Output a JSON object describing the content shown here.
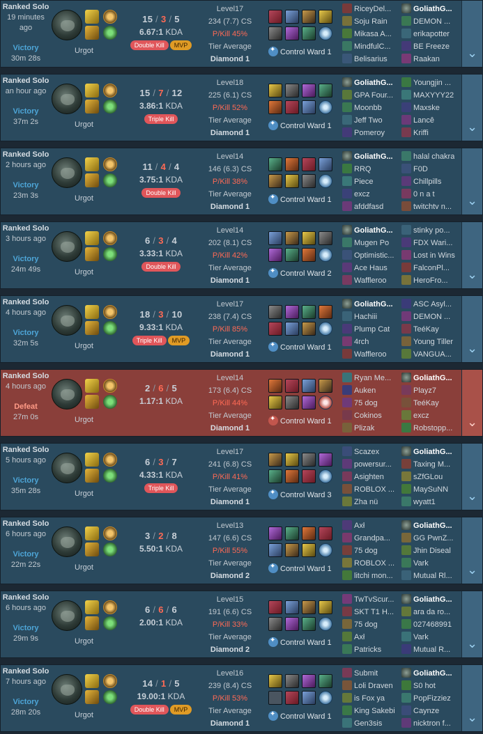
{
  "champion": "Urgot",
  "ward_prefix": "Control Ward",
  "tier_label": "Tier Average",
  "colors": {
    "win_bg": "#2a4a5e",
    "loss_bg": "#8a3f3a",
    "deaths": "#ff6a55",
    "pkill": "#ff6a55",
    "multi_kill": "#e0565a",
    "mvp": "#e09b25"
  },
  "icons": {
    "expand": "chevron-down-icon",
    "ward": "control-ward-icon"
  },
  "matches": [
    {
      "queue": "Ranked Solo",
      "ago": "19 minutes ago",
      "result": "Victory",
      "length": "30m 28s",
      "k": "15",
      "d": "3",
      "a": "5",
      "ratio": "6.67:1",
      "kda_suffix": "KDA",
      "badges": [
        "Double Kill",
        "MVP"
      ],
      "level": "Level17",
      "cs": "234 (7.7) CS",
      "pkill": "P/Kill 45%",
      "tier": "Tier Average",
      "rank": "Diamond 1",
      "wards": "1",
      "team1": [
        "RiceyDel...",
        "Soju Rain",
        "Mikasa A...",
        "MindfulC...",
        "Belisarius"
      ],
      "team2": [
        "GoliathG...",
        "DEMON ...",
        "erikapotter",
        "BE Freeze",
        "Raakan"
      ],
      "me": "2-0"
    },
    {
      "queue": "Ranked Solo",
      "ago": "an hour ago",
      "result": "Victory",
      "length": "37m 2s",
      "k": "15",
      "d": "7",
      "a": "12",
      "ratio": "3.86:1",
      "kda_suffix": "KDA",
      "badges": [
        "Triple Kill"
      ],
      "level": "Level18",
      "cs": "225 (6.1) CS",
      "pkill": "P/Kill 52%",
      "tier": "Tier Average",
      "rank": "Diamond 1",
      "wards": "1",
      "team1": [
        "GoliathG...",
        "GPA Four...",
        "Moonbb",
        "Jeff Two",
        "Pomeroy"
      ],
      "team2": [
        "Youngjin ...",
        "MAXYYY22",
        "Maxske",
        "Lancê",
        "Kriffi"
      ],
      "me": "1-0"
    },
    {
      "queue": "Ranked Solo",
      "ago": "2 hours ago",
      "result": "Victory",
      "length": "23m 3s",
      "k": "11",
      "d": "4",
      "a": "4",
      "ratio": "3.75:1",
      "kda_suffix": "KDA",
      "badges": [
        "Double Kill"
      ],
      "level": "Level14",
      "cs": "146 (6.3) CS",
      "pkill": "P/Kill 38%",
      "tier": "Tier Average",
      "rank": "Diamond 1",
      "wards": "1",
      "team1": [
        "GoliathG...",
        "RRQ",
        "Piece",
        "excz",
        "afddfasd"
      ],
      "team2": [
        "halal chakra",
        "F0D",
        "Chillpills",
        "0 n a t",
        "twitchtv n..."
      ],
      "me": "1-0"
    },
    {
      "queue": "Ranked Solo",
      "ago": "3 hours ago",
      "result": "Victory",
      "length": "24m 49s",
      "k": "6",
      "d": "3",
      "a": "4",
      "ratio": "3.33:1",
      "kda_suffix": "KDA",
      "badges": [
        "Double Kill"
      ],
      "level": "Level14",
      "cs": "202 (8.1) CS",
      "pkill": "P/Kill 42%",
      "tier": "Tier Average",
      "rank": "Diamond 1",
      "wards": "2",
      "team1": [
        "GoliathG...",
        "Mugen Po",
        "Optimistic...",
        "Ace Haus",
        "Waffleroo"
      ],
      "team2": [
        "stinky po...",
        "FDX Wari...",
        "Lost in Wins",
        "FalconPl...",
        "HeroFro..."
      ],
      "me": "1-0"
    },
    {
      "queue": "Ranked Solo",
      "ago": "4 hours ago",
      "result": "Victory",
      "length": "32m 5s",
      "k": "18",
      "d": "3",
      "a": "10",
      "ratio": "9.33:1",
      "kda_suffix": "KDA",
      "badges": [
        "Triple Kill",
        "MVP"
      ],
      "level": "Level17",
      "cs": "238 (7.4) CS",
      "pkill": "P/Kill 85%",
      "tier": "Tier Average",
      "rank": "Diamond 1",
      "wards": "1",
      "team1": [
        "GoliathG...",
        "Hachiii",
        "Plump Cat",
        "4rch",
        "Waffleroo"
      ],
      "team2": [
        "ASC Asyl...",
        "DEMON ...",
        "TeéKay",
        "Young Tiller",
        "VANGUA..."
      ],
      "me": "1-0"
    },
    {
      "queue": "Ranked Solo",
      "ago": "4 hours ago",
      "result": "Defeat",
      "length": "27m 0s",
      "k": "2",
      "d": "6",
      "a": "5",
      "ratio": "1.17:1",
      "kda_suffix": "KDA",
      "badges": [],
      "level": "Level14",
      "cs": "173 (6.4) CS",
      "pkill": "P/Kill 44%",
      "tier": "Tier Average",
      "rank": "Diamond 1",
      "wards": "1",
      "team1": [
        "Ryan Me...",
        "Auken",
        "75 dog",
        "Cokinos",
        "Plizak"
      ],
      "team2": [
        "GoliathG...",
        "Playz7",
        "TeéKay",
        "excz",
        "Robstopp..."
      ],
      "me": "2-0"
    },
    {
      "queue": "Ranked Solo",
      "ago": "5 hours ago",
      "result": "Victory",
      "length": "35m 28s",
      "k": "6",
      "d": "3",
      "a": "7",
      "ratio": "4.33:1",
      "kda_suffix": "KDA",
      "badges": [
        "Triple Kill"
      ],
      "level": "Level17",
      "cs": "241 (6.8) CS",
      "pkill": "P/Kill 41%",
      "tier": "Tier Average",
      "rank": "Diamond 1",
      "wards": "3",
      "team1": [
        "Scazex",
        "powersur...",
        "Asighten",
        "ROBLOX ...",
        "Zha nü"
      ],
      "team2": [
        "GoliathG...",
        "Taxing M...",
        "sZfGLou",
        "MaySuNN",
        "wyatt1"
      ],
      "me": "2-0"
    },
    {
      "queue": "Ranked Solo",
      "ago": "6 hours ago",
      "result": "Victory",
      "length": "22m 22s",
      "k": "3",
      "d": "2",
      "a": "8",
      "ratio": "5.50:1",
      "kda_suffix": "KDA",
      "badges": [],
      "level": "Level13",
      "cs": "147 (6.6) CS",
      "pkill": "P/Kill 55%",
      "tier": "Tier Average",
      "rank": "Diamond 2",
      "wards": "1",
      "team1": [
        "Axł",
        "Grandpa...",
        "75 dog",
        "ROBLOX ...",
        "litchi mon..."
      ],
      "team2": [
        "GoliathG...",
        "GG PwnZ...",
        "Jhin Diseal",
        "Vark",
        "Mutual Rl..."
      ],
      "me": "2-0"
    },
    {
      "queue": "Ranked Solo",
      "ago": "6 hours ago",
      "result": "Victory",
      "length": "29m 9s",
      "k": "6",
      "d": "6",
      "a": "6",
      "ratio": "2.00:1",
      "kda_suffix": "KDA",
      "badges": [],
      "level": "Level15",
      "cs": "191 (6.6) CS",
      "pkill": "P/Kill 33%",
      "tier": "Tier Average",
      "rank": "Diamond 2",
      "wards": "1",
      "team1": [
        "TwTvScur...",
        "SKT T1 H...",
        "75 dog",
        "Axł",
        "Patricks"
      ],
      "team2": [
        "GoliathG...",
        "ara da ro...",
        "027468991",
        "Vark",
        "Mutual R..."
      ],
      "me": "2-0"
    },
    {
      "queue": "Ranked Solo",
      "ago": "7 hours ago",
      "result": "Victory",
      "length": "28m 20s",
      "k": "14",
      "d": "1",
      "a": "5",
      "ratio": "19.00:1",
      "kda_suffix": "KDA",
      "badges": [
        "Double Kill",
        "MVP"
      ],
      "level": "Level16",
      "cs": "239 (8.4) CS",
      "pkill": "P/Kill 53%",
      "tier": "Tier Average",
      "rank": "Diamond 1",
      "wards": "1",
      "team1": [
        "Submit",
        "Loli Draven",
        "is Fox ya",
        "King Sakebi",
        "Gen3sis"
      ],
      "team2": [
        "GoliathG...",
        "S0 hot",
        "PopFizziez",
        "Caynze",
        "nicktron f..."
      ],
      "me": "2-0"
    }
  ]
}
